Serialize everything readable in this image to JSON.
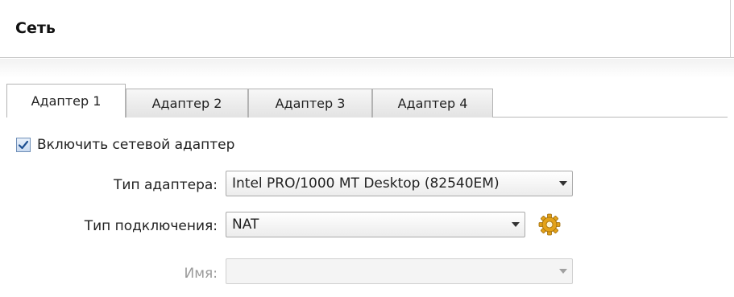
{
  "header": {
    "title": "Сеть"
  },
  "tabs": [
    {
      "label": "Адаптер 1",
      "active": true
    },
    {
      "label": "Адаптер 2",
      "active": false
    },
    {
      "label": "Адаптер 3",
      "active": false
    },
    {
      "label": "Адаптер 4",
      "active": false
    }
  ],
  "enable_adapter": {
    "label": "Включить сетевой адаптер",
    "checked": true
  },
  "adapter_type": {
    "label": "Тип адаптера:",
    "value": "Intel PRO/1000 MT Desktop (82540EM)"
  },
  "attached_to": {
    "label": "Тип подключения:",
    "value": "NAT",
    "settings_icon": "gear-icon"
  },
  "name": {
    "label": "Имя:",
    "value": "",
    "enabled": false
  },
  "colors": {
    "accent_checkbox": "#6f8fb8",
    "gear": "#e0a81c",
    "disabled_text": "#9a9a9a"
  }
}
